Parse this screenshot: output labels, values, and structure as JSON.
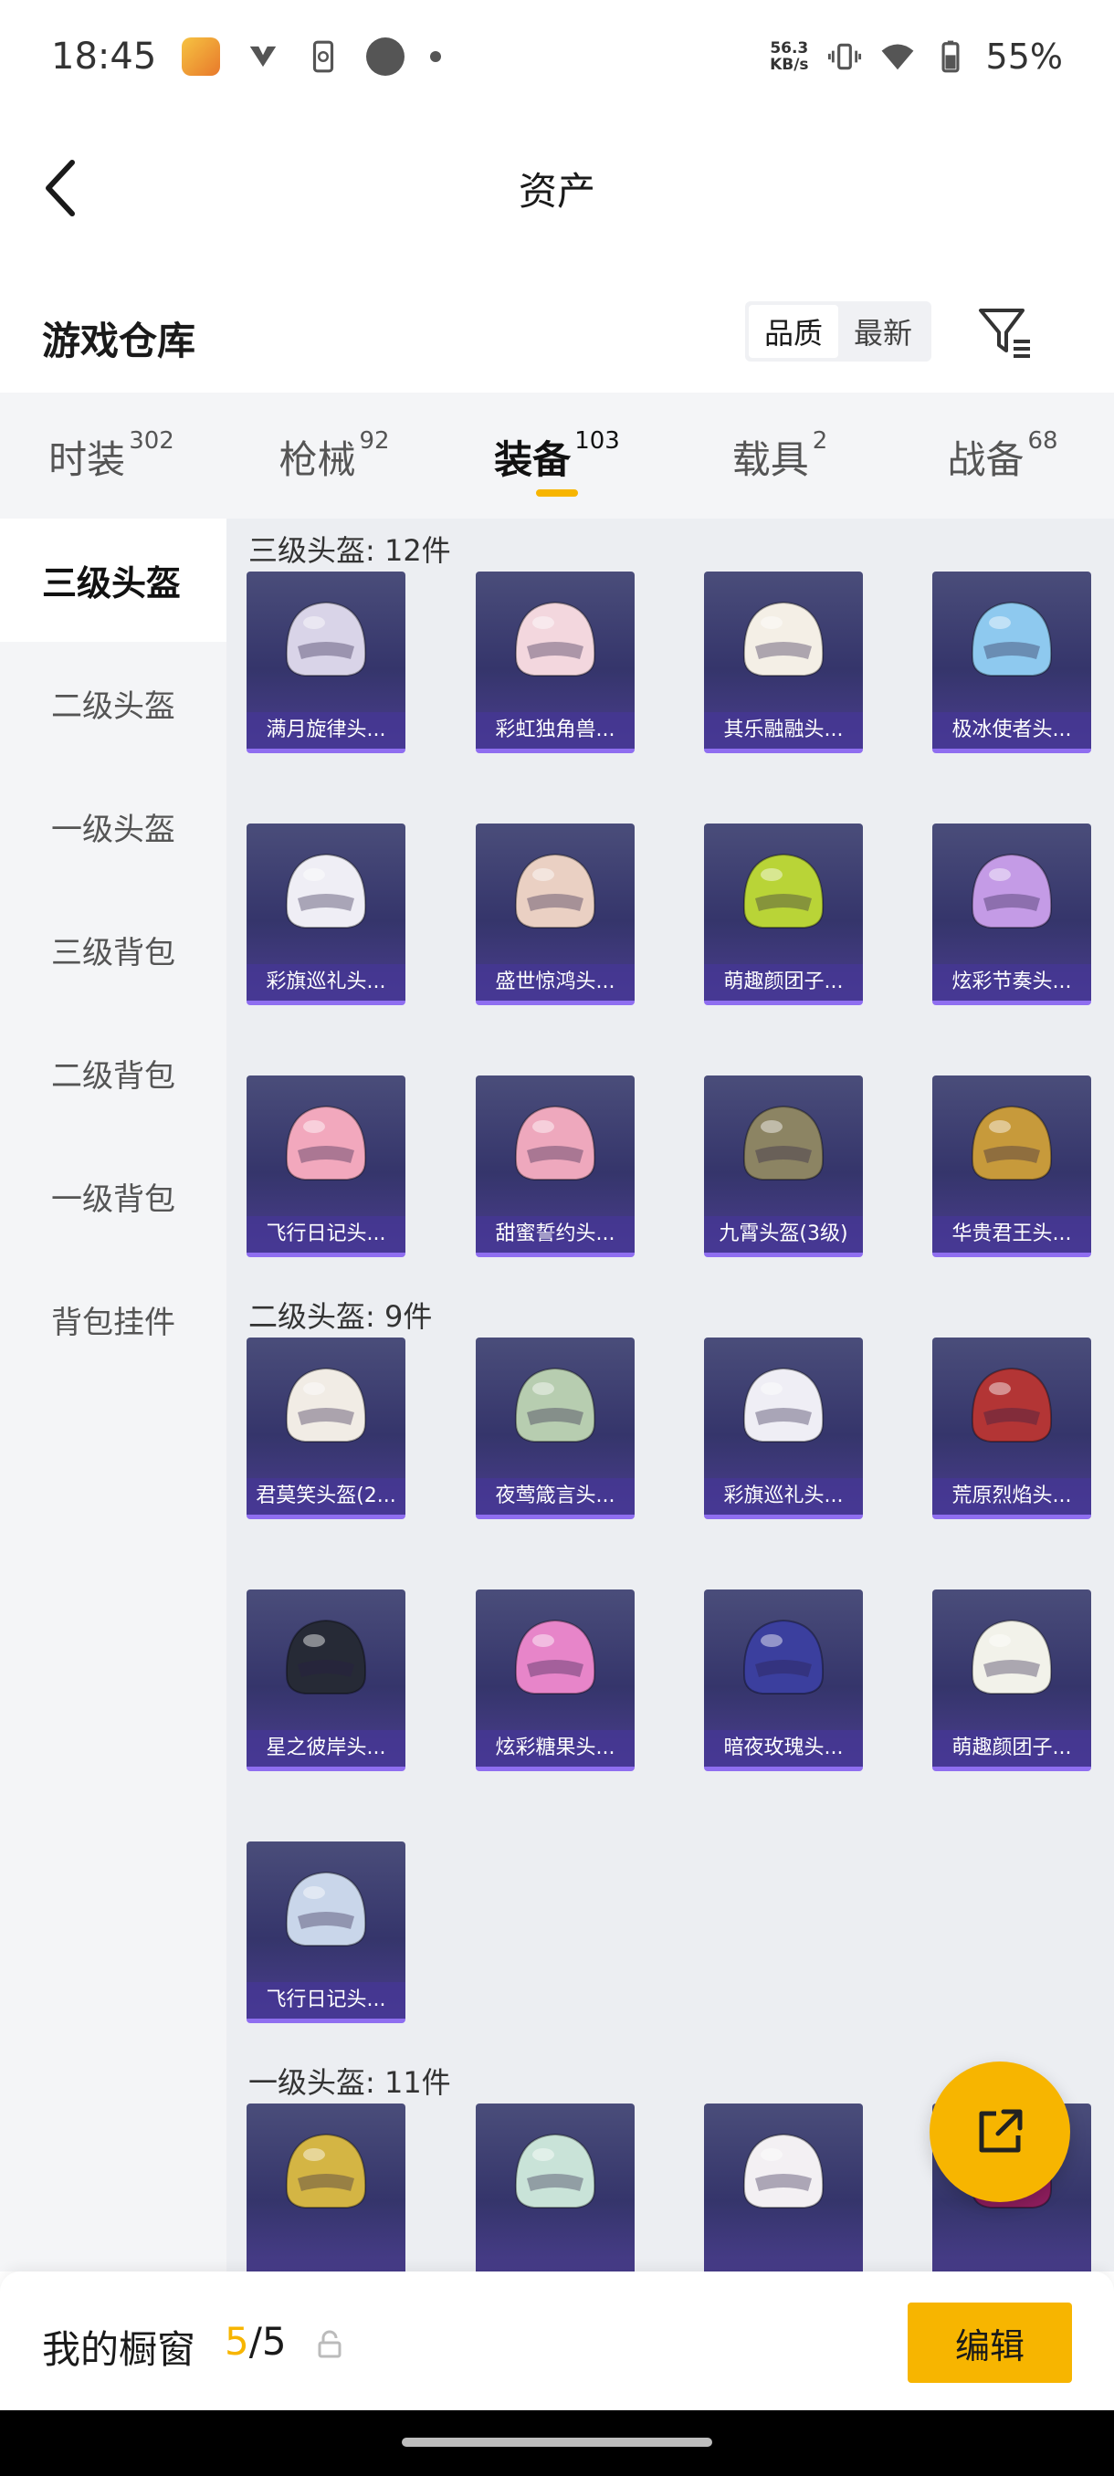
{
  "status_bar": {
    "time": "18:45",
    "net_speed_value": "56.3",
    "net_speed_unit": "KB/s",
    "battery": "55%"
  },
  "header": {
    "title": "资产"
  },
  "warehouse": {
    "title": "游戏仓库",
    "sort_options": [
      "品质",
      "最新"
    ],
    "active_sort": "品质"
  },
  "tabs": [
    {
      "label": "时装",
      "count": "302"
    },
    {
      "label": "枪械",
      "count": "92"
    },
    {
      "label": "装备",
      "count": "103"
    },
    {
      "label": "载具",
      "count": "2"
    },
    {
      "label": "战备",
      "count": "68"
    }
  ],
  "active_tab": "装备",
  "sidebar": {
    "items": [
      "三级头盔",
      "二级头盔",
      "一级头盔",
      "三级背包",
      "二级背包",
      "一级背包",
      "背包挂件"
    ],
    "active": "三级头盔"
  },
  "groups": [
    {
      "title": "三级头盔: 12件",
      "items": [
        {
          "name": "满月旋律头...",
          "color": "#d9d4e8"
        },
        {
          "name": "彩虹独角兽...",
          "color": "#f3d7de"
        },
        {
          "name": "其乐融融头...",
          "color": "#f4efe6"
        },
        {
          "name": "极冰使者头...",
          "color": "#8ec9ef"
        },
        {
          "name": "彩旗巡礼头...",
          "color": "#efeef5"
        },
        {
          "name": "盛世惊鸿头...",
          "color": "#ead0c3"
        },
        {
          "name": "萌趣颜团子...",
          "color": "#b9d437"
        },
        {
          "name": "炫彩节奏头...",
          "color": "#c49be6"
        },
        {
          "name": "飞行日记头...",
          "color": "#f2a8bd"
        },
        {
          "name": "甜蜜誓约头...",
          "color": "#eea8bd"
        },
        {
          "name": "九霄头盔(3级)",
          "color": "#8c8463"
        },
        {
          "name": "华贵君王头...",
          "color": "#c79a3b"
        }
      ]
    },
    {
      "title": "二级头盔: 9件",
      "items": [
        {
          "name": "君莫笑头盔(2...",
          "color": "#f1ece5"
        },
        {
          "name": "夜莺箴言头...",
          "color": "#b7cdb0"
        },
        {
          "name": "彩旗巡礼头...",
          "color": "#efeef5"
        },
        {
          "name": "荒原烈焰头...",
          "color": "#b33535"
        },
        {
          "name": "星之彼岸头...",
          "color": "#262a36"
        },
        {
          "name": "炫彩糖果头...",
          "color": "#e785c9"
        },
        {
          "name": "暗夜玫瑰头...",
          "color": "#3b3f9e"
        },
        {
          "name": "萌趣颜团子...",
          "color": "#f2f2ea"
        },
        {
          "name": "飞行日记头...",
          "color": "#c9d6ea"
        }
      ]
    },
    {
      "title": "一级头盔: 11件",
      "items": [
        {
          "name": "",
          "color": "#d4b544"
        },
        {
          "name": "",
          "color": "#c9e3d8"
        },
        {
          "name": "",
          "color": "#f3f0f3"
        },
        {
          "name": "",
          "color": "#8f1e5e"
        }
      ]
    }
  ],
  "showcase": {
    "label": "我的橱窗",
    "current": "5",
    "separator": "/",
    "total": "5"
  },
  "edit_label": "编辑",
  "colors": {
    "accent": "#f7b500",
    "card_bg": "#35356b",
    "card_border": "#8f6ef0"
  }
}
